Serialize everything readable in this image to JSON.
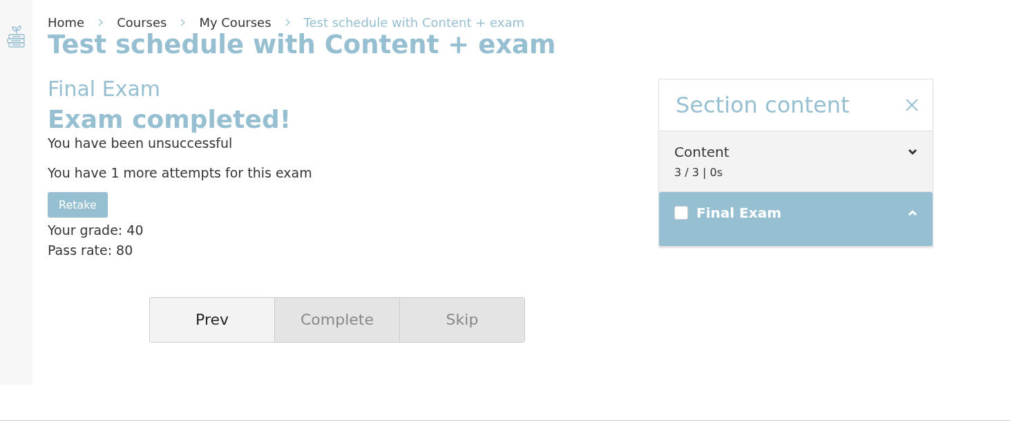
{
  "breadcrumb": [
    {
      "label": "Home",
      "current": false
    },
    {
      "label": "Courses",
      "current": false
    },
    {
      "label": "My Courses",
      "current": false
    },
    {
      "label": "Test schedule with Content + exam",
      "current": true
    }
  ],
  "course_title": "Test schedule with Content + exam",
  "lesson_title": "Final Exam",
  "result": {
    "heading": "Exam completed!",
    "message": "You have been unsuccessful",
    "attempts": "You have 1 more attempts for this exam",
    "retake_button": "Retake",
    "grade": "Your grade: 40",
    "pass_rate": "Pass rate: 80"
  },
  "nav_buttons": [
    {
      "label": "Prev",
      "disabled": false
    },
    {
      "label": "Complete",
      "disabled": true
    },
    {
      "label": "Skip",
      "disabled": true
    }
  ],
  "sidebar": {
    "title": "Section content",
    "sections": [
      {
        "title": "Content",
        "meta": "3 / 3 | 0s",
        "expanded": false,
        "selected": false
      },
      {
        "title": "Final Exam",
        "checked": false,
        "expanded": true,
        "selected": true
      }
    ]
  }
}
